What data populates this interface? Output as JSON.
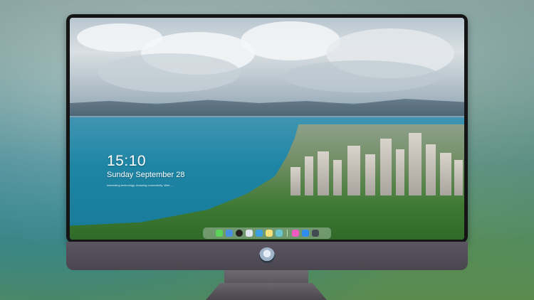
{
  "lockscreen": {
    "time": "15:10",
    "date": "Sunday September 28",
    "caption": "Interesting technology. Amazing connectivity. Web ..."
  },
  "dock": {
    "items": [
      {
        "name": "messages-icon",
        "color": "#5ad55a"
      },
      {
        "name": "finder-icon",
        "color": "#4a90e2"
      },
      {
        "name": "clock-icon",
        "color": "#222222"
      },
      {
        "name": "preview-icon",
        "color": "#dfe6ee"
      },
      {
        "name": "video-icon",
        "color": "#3aa0e0"
      },
      {
        "name": "notes-icon",
        "color": "#f5e07a"
      },
      {
        "name": "photos-icon",
        "color": "#6cc3d0"
      },
      {
        "name": "music-icon",
        "color": "#f05abe"
      },
      {
        "name": "app-store-icon",
        "color": "#2f8cf0"
      },
      {
        "name": "camera-icon",
        "color": "#444a52"
      }
    ]
  },
  "colors": {
    "bezel": "#151515",
    "chin": "#524e58",
    "sea": "#1f85a5"
  }
}
